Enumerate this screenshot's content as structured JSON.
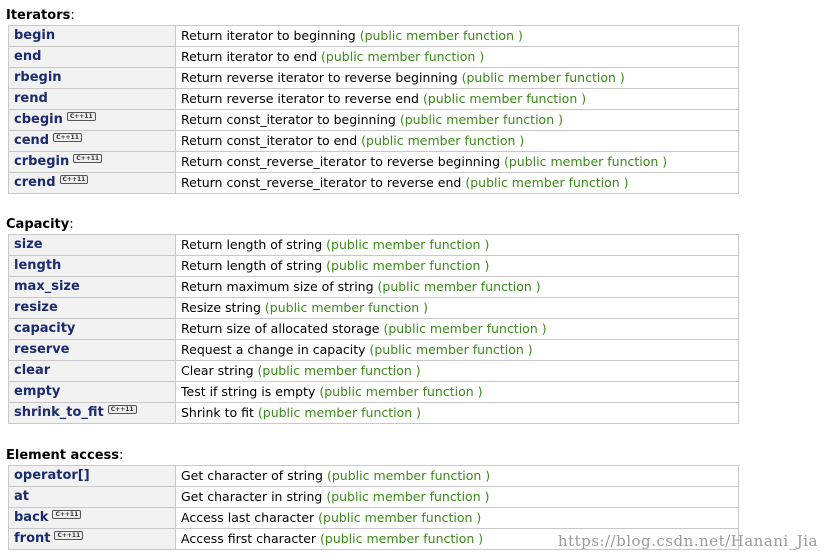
{
  "sections": {
    "iterators": {
      "heading": "Iterators",
      "rows": [
        {
          "name": "begin",
          "c11": false,
          "desc": "Return iterator to beginning",
          "kind": "(public member function )"
        },
        {
          "name": "end",
          "c11": false,
          "desc": "Return iterator to end",
          "kind": "(public member function )"
        },
        {
          "name": "rbegin",
          "c11": false,
          "desc": "Return reverse iterator to reverse beginning",
          "kind": "(public member function )"
        },
        {
          "name": "rend",
          "c11": false,
          "desc": "Return reverse iterator to reverse end",
          "kind": "(public member function )"
        },
        {
          "name": "cbegin",
          "c11": true,
          "desc": "Return const_iterator to beginning",
          "kind": "(public member function )"
        },
        {
          "name": "cend",
          "c11": true,
          "desc": "Return const_iterator to end",
          "kind": "(public member function )"
        },
        {
          "name": "crbegin",
          "c11": true,
          "desc": "Return const_reverse_iterator to reverse beginning",
          "kind": "(public member function )"
        },
        {
          "name": "crend",
          "c11": true,
          "desc": "Return const_reverse_iterator to reverse end",
          "kind": "(public member function )"
        }
      ]
    },
    "capacity": {
      "heading": "Capacity",
      "rows": [
        {
          "name": "size",
          "c11": false,
          "desc": "Return length of string",
          "kind": "(public member function )"
        },
        {
          "name": "length",
          "c11": false,
          "desc": "Return length of string",
          "kind": "(public member function )"
        },
        {
          "name": "max_size",
          "c11": false,
          "desc": "Return maximum size of string",
          "kind": "(public member function )"
        },
        {
          "name": "resize",
          "c11": false,
          "desc": "Resize string",
          "kind": "(public member function )"
        },
        {
          "name": "capacity",
          "c11": false,
          "desc": "Return size of allocated storage",
          "kind": "(public member function )"
        },
        {
          "name": "reserve",
          "c11": false,
          "desc": "Request a change in capacity",
          "kind": "(public member function )"
        },
        {
          "name": "clear",
          "c11": false,
          "desc": "Clear string",
          "kind": "(public member function )"
        },
        {
          "name": "empty",
          "c11": false,
          "desc": "Test if string is empty",
          "kind": "(public member function )"
        },
        {
          "name": "shrink_to_fit",
          "c11": true,
          "desc": "Shrink to fit",
          "kind": "(public member function )"
        }
      ]
    },
    "element_access": {
      "heading": "Element access",
      "rows": [
        {
          "name": "operator[]",
          "c11": false,
          "desc": "Get character of string",
          "kind": "(public member function )"
        },
        {
          "name": "at",
          "c11": false,
          "desc": "Get character in string",
          "kind": "(public member function )"
        },
        {
          "name": "back",
          "c11": true,
          "desc": "Access last character",
          "kind": "(public member function )"
        },
        {
          "name": "front",
          "c11": true,
          "desc": "Access first character",
          "kind": "(public member function )"
        }
      ]
    }
  },
  "badge_label": "C++11",
  "watermark": "https://blog.csdn.net/Hanani_Jia"
}
